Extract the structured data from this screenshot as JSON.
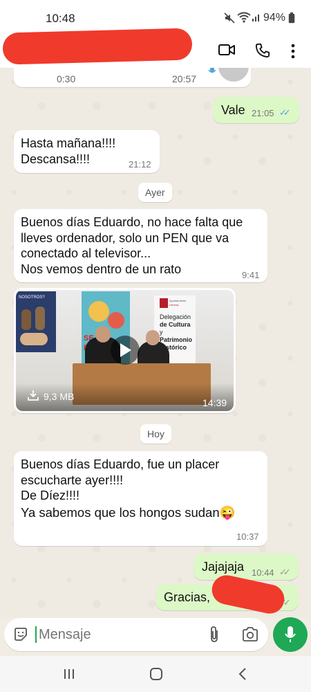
{
  "status_bar": {
    "time": "10:48",
    "battery": "94%"
  },
  "chat": {
    "voice_note": {
      "duration": "0:30",
      "time": "20:57"
    },
    "messages": [
      {
        "dir": "out",
        "text": "Vale",
        "time": "21:05",
        "ticks": "✓✓"
      },
      {
        "dir": "in",
        "text": "Hasta mañana!!!!\nDescansa!!!!",
        "time": "21:12"
      },
      {
        "dir": "in",
        "text": "Buenos días Eduardo, no hace falta que\nlleves ordenador, solo un PEN que va\nconectado al televisor...\nNos vemos dentro de un rato",
        "time": "9:41"
      },
      {
        "dir": "in",
        "text": "Buenos días Eduardo, fue un placer\nescucharte ayer!!!!\nDe Díez!!!!",
        "text2": "Ya sabemos que los hongos sudan😜",
        "time": "10:37"
      },
      {
        "dir": "out",
        "text": "Jajajaja",
        "time": "10:44",
        "ticks": "✓✓"
      },
      {
        "dir": "out",
        "text": "Gracias,",
        "ticks": "✓✓"
      }
    ],
    "day_chips": [
      "Ayer",
      "Hoy"
    ],
    "video": {
      "size": "9,3 MB",
      "duration": "14:39",
      "poster_text": [
        "NOSOTROS?",
        "SE",
        "DE",
        "Ayuntamiento",
        "Llerena",
        "Delegación",
        "de Cultura",
        "y",
        "Patrimonio",
        "Histórico"
      ]
    }
  },
  "input": {
    "placeholder": "Mensaje"
  },
  "colors": {
    "accent": "#1fa855",
    "out_bubble": "#dcf8c6",
    "tick_blue": "#4fa3e0",
    "redaction": "#f03a2c"
  }
}
